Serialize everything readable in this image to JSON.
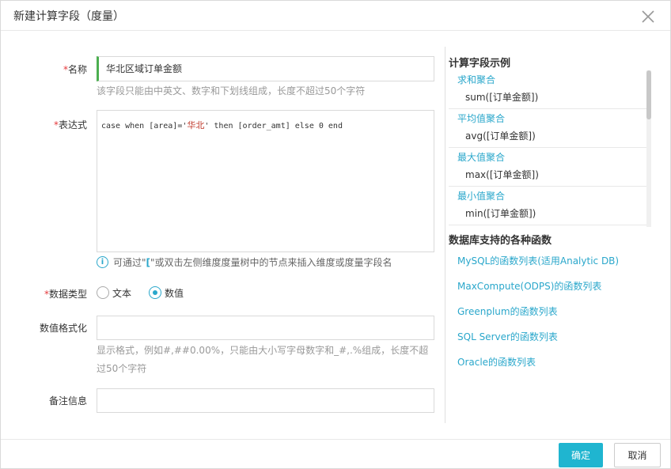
{
  "dialog": {
    "title": "新建计算字段（度量）"
  },
  "form": {
    "name": {
      "required_mark": "*",
      "label": "名称",
      "value": "华北区域订单金额",
      "hint": "该字段只能由中英文、数字和下划线组成，长度不超过50个字符"
    },
    "expression": {
      "required_mark": "*",
      "label": "表达式",
      "code_part1": "case when [area]='",
      "code_cn": "华北",
      "code_part2": "' then [order_amt] else 0 end",
      "info_icon": "info-icon",
      "info_prefix": "可通过\"",
      "info_bracket": "[",
      "info_suffix": "\"或双击左侧维度度量树中的节点来插入维度或度量字段名"
    },
    "data_type": {
      "required_mark": "*",
      "label": "数据类型",
      "options": [
        {
          "label": "文本",
          "checked": false
        },
        {
          "label": "数值",
          "checked": true
        }
      ]
    },
    "number_format": {
      "label": "数值格式化",
      "value": "",
      "hint_line1": "显示格式，例如#,##0.00%，只能由大小写字母数字和_#,.%组成，长度不超",
      "hint_line2": "过50个字符"
    },
    "remark": {
      "label": "备注信息",
      "value": ""
    }
  },
  "examples": {
    "title": "计算字段示例",
    "items": [
      {
        "name": "求和聚合",
        "code": "sum([订单金额])"
      },
      {
        "name": "平均值聚合",
        "code": "avg([订单金额])"
      },
      {
        "name": "最大值聚合",
        "code": "max([订单金额])"
      },
      {
        "name": "最小值聚合",
        "code": "min([订单金额])"
      }
    ]
  },
  "functions": {
    "title": "数据库支持的各种函数",
    "links": [
      "MySQL的函数列表(适用Analytic DB)",
      "MaxCompute(ODPS)的函数列表",
      "Greenplum的函数列表",
      "SQL Server的函数列表",
      "Oracle的函数列表"
    ]
  },
  "footer": {
    "ok_label": "确定",
    "cancel_label": "取消"
  },
  "colors": {
    "accent": "#1fb5d0",
    "link": "#2aa7cb",
    "required": "#e4393c"
  }
}
